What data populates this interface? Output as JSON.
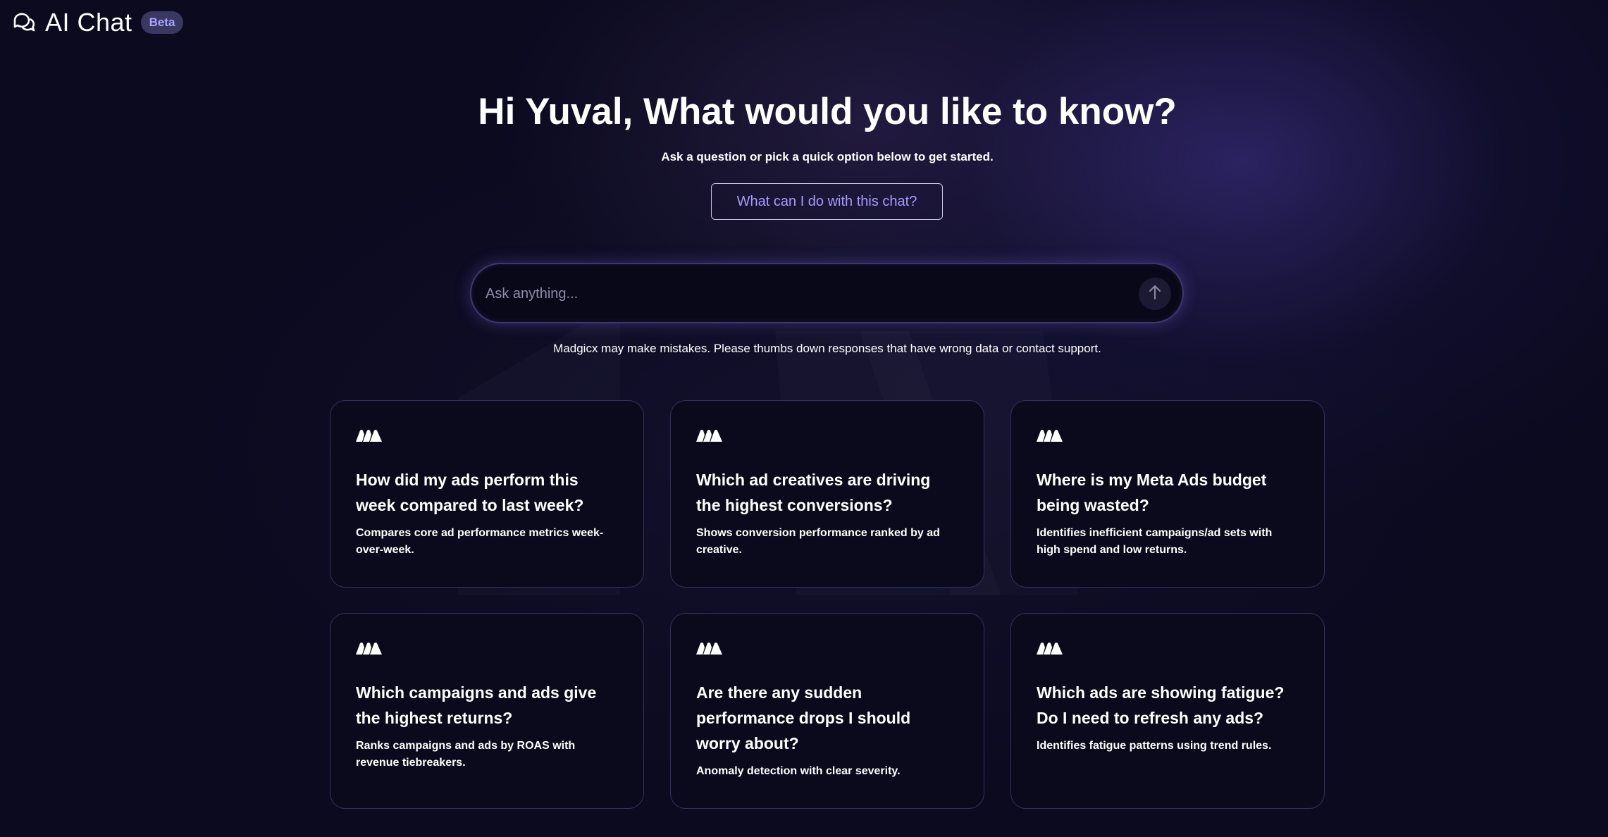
{
  "header": {
    "title": "AI Chat",
    "badge": "Beta",
    "icon": "chat-bubbles-icon"
  },
  "hero": {
    "title": "Hi Yuval, What would you like to know?",
    "subtitle": "Ask a question or pick a quick option below to get started.",
    "help_button_label": "What can I do with this chat?"
  },
  "search": {
    "placeholder": "Ask anything...",
    "value": "",
    "send_icon": "arrow-up-icon"
  },
  "disclaimer": "Madgicx may make mistakes. Please thumbs down responses that have wrong data or contact support.",
  "colors": {
    "background": "#0b0a1f",
    "accent": "#a79bff",
    "badge_bg": "#3a3760",
    "card_border": "#34325a"
  },
  "cards": [
    {
      "icon": "madgicx-logo-icon",
      "title": "How did my ads perform this week compared to last week?",
      "description": "Compares core ad performance metrics week-over-week."
    },
    {
      "icon": "madgicx-logo-icon",
      "title": "Which ad creatives are driving the highest conversions?",
      "description": "Shows conversion performance ranked by ad creative."
    },
    {
      "icon": "madgicx-logo-icon",
      "title": "Where is my Meta Ads budget being wasted?",
      "description": "Identifies inefficient campaigns/ad sets with high spend and low returns."
    },
    {
      "icon": "madgicx-logo-icon",
      "title": "Which campaigns and ads give the highest returns?",
      "description": "Ranks campaigns and ads by ROAS with revenue tiebreakers."
    },
    {
      "icon": "madgicx-logo-icon",
      "title": "Are there any sudden performance drops I should worry about?",
      "description": "Anomaly detection with clear severity."
    },
    {
      "icon": "madgicx-logo-icon",
      "title": "Which ads are showing fatigue? Do I need to refresh any ads?",
      "description": "Identifies fatigue patterns using trend rules."
    }
  ]
}
